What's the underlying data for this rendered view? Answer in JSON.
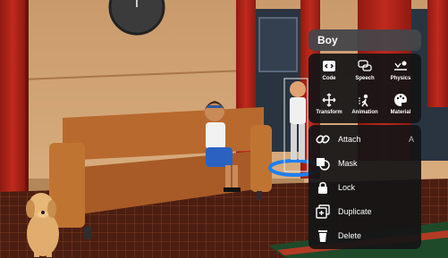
{
  "context_menu": {
    "title": "Boy",
    "tools": [
      {
        "label": "Code",
        "icon": "code-icon"
      },
      {
        "label": "Speech",
        "icon": "speech-icon"
      },
      {
        "label": "Physics",
        "icon": "physics-icon"
      },
      {
        "label": "Transform",
        "icon": "transform-icon"
      },
      {
        "label": "Animation",
        "icon": "animation-icon"
      },
      {
        "label": "Material",
        "icon": "material-icon"
      }
    ],
    "actions": [
      {
        "label": "Attach",
        "shortcut": "A",
        "icon": "attach-icon"
      },
      {
        "label": "Mask",
        "shortcut": "",
        "icon": "mask-icon"
      },
      {
        "label": "Lock",
        "shortcut": "",
        "icon": "lock-icon"
      },
      {
        "label": "Duplicate",
        "shortcut": "",
        "icon": "duplicate-icon"
      },
      {
        "label": "Delete",
        "shortcut": "",
        "icon": "delete-icon"
      }
    ]
  },
  "colors": {
    "wall": "#c79a6b",
    "curtain": "#b3261b",
    "sofa": "#b7692f",
    "floor": "#4a1d12",
    "panel": "#141416",
    "selection_ring": "#1e7ff0"
  }
}
